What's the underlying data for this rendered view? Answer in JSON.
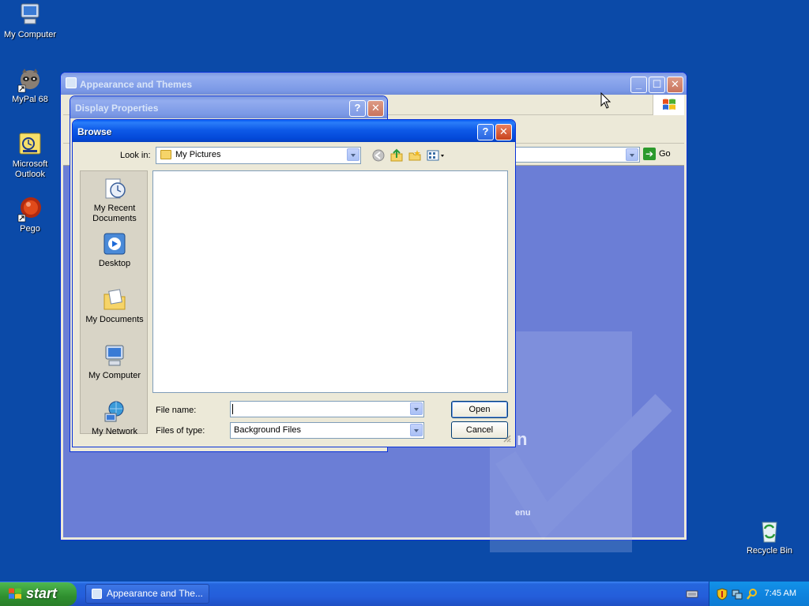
{
  "desktop": {
    "icons": [
      {
        "label": "My Computer"
      },
      {
        "label": "MyPal 68"
      },
      {
        "label": "Microsoft Outlook"
      },
      {
        "label": "Pego"
      },
      {
        "label": "Recycle Bin"
      }
    ]
  },
  "appearance_window": {
    "title": "Appearance and Themes",
    "address_go": "Go",
    "background_heading": "n",
    "background_menu_text": "enu"
  },
  "display_properties": {
    "title": "Display Properties"
  },
  "browse_dialog": {
    "title": "Browse",
    "look_in_label": "Look in:",
    "look_in_value": "My Pictures",
    "places": [
      {
        "label": "My Recent Documents"
      },
      {
        "label": "Desktop"
      },
      {
        "label": "My Documents"
      },
      {
        "label": "My Computer"
      },
      {
        "label": "My Network"
      }
    ],
    "file_name_label": "File name:",
    "file_name_value": "",
    "files_of_type_label": "Files of type:",
    "files_of_type_value": "Background Files",
    "open_button": "Open",
    "cancel_button": "Cancel"
  },
  "taskbar": {
    "start_label": "start",
    "task_label": "Appearance and The...",
    "clock": "7:45 AM"
  },
  "colors": {
    "desktop": "#0b4aa8",
    "titlebar_active": "#0348d8",
    "control_panel_bg": "#6b7ed6"
  }
}
